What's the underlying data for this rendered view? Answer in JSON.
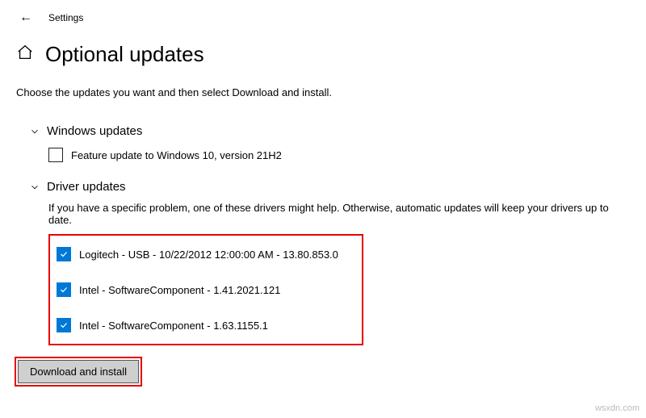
{
  "topbar": {
    "settings_label": "Settings"
  },
  "header": {
    "title": "Optional updates"
  },
  "description": "Choose the updates you want and then select Download and install.",
  "sections": {
    "windows": {
      "title": "Windows updates",
      "item_label": "Feature update to Windows 10, version 21H2"
    },
    "driver": {
      "title": "Driver updates",
      "desc": "If you have a specific problem, one of these drivers might help. Otherwise, automatic updates will keep your drivers up to date.",
      "items": [
        {
          "label": "Logitech - USB - 10/22/2012 12:00:00 AM - 13.80.853.0"
        },
        {
          "label": "Intel - SoftwareComponent - 1.41.2021.121"
        },
        {
          "label": "Intel - SoftwareComponent - 1.63.1155.1"
        }
      ]
    }
  },
  "button": {
    "download_label": "Download and install"
  },
  "watermark": "wsxdn.com"
}
